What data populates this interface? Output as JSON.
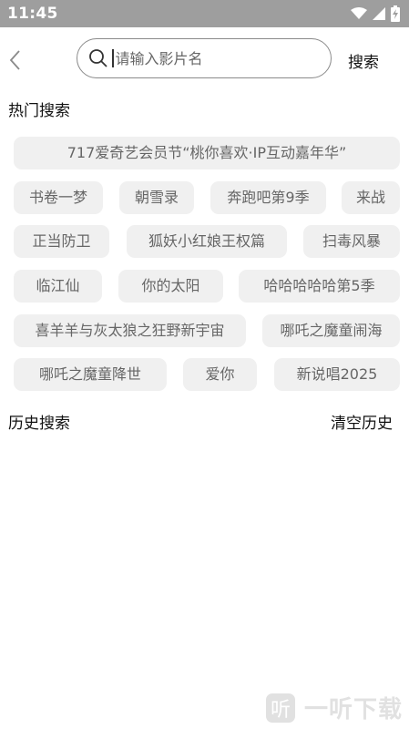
{
  "status_bar": {
    "time": "11:45"
  },
  "search": {
    "placeholder": "请输入影片名",
    "button_label": "搜索"
  },
  "hot": {
    "title": "热门搜索",
    "tags": [
      "717爱奇艺会员节“桃你喜欢·IP互动嘉年华”",
      "书卷一梦",
      "朝雪录",
      "奔跑吧第9季",
      "来战",
      "正当防卫",
      "狐妖小红娘王权篇",
      "扫毒风暴",
      "临江仙",
      "你的太阳",
      "哈哈哈哈哈第5季",
      "喜羊羊与灰太狼之狂野新宇宙",
      "哪吒之魔童闹海",
      "哪吒之魔童降世",
      "爱你",
      "新说唱2025"
    ]
  },
  "history": {
    "title": "历史搜索",
    "clear_label": "清空历史"
  },
  "watermark": {
    "text": "一听下载"
  },
  "colors": {
    "status_bar_bg": "#9e9e9e",
    "tag_bg": "#f0f0f0",
    "tag_text": "#666666"
  }
}
